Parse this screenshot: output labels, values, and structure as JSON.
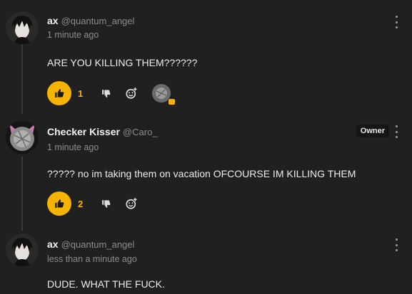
{
  "comments": [
    {
      "name": "ax",
      "handle": "@quantum_angel",
      "time": "1 minute ago",
      "text": "ARE YOU KILLING THEM??????",
      "likes": "1",
      "has_reaction": true
    },
    {
      "name": "Checker Kisser",
      "handle": "@Caro_",
      "time": "1 minute ago",
      "text": "????? no im taking them on vacation OFCOURSE IM KILLING THEM",
      "likes": "2",
      "badge": "Owner"
    },
    {
      "name": "ax",
      "handle": "@quantum_angel",
      "time": "less than a minute ago",
      "text": "DUDE. WHAT THE FUCK."
    }
  ],
  "colors": {
    "background": "#202020",
    "accent": "#f5b400",
    "muted": "#8c8c8c"
  },
  "icons": [
    "thumbs-up-icon",
    "thumbs-down-icon",
    "add-reaction-icon",
    "more-vertical-icon"
  ]
}
